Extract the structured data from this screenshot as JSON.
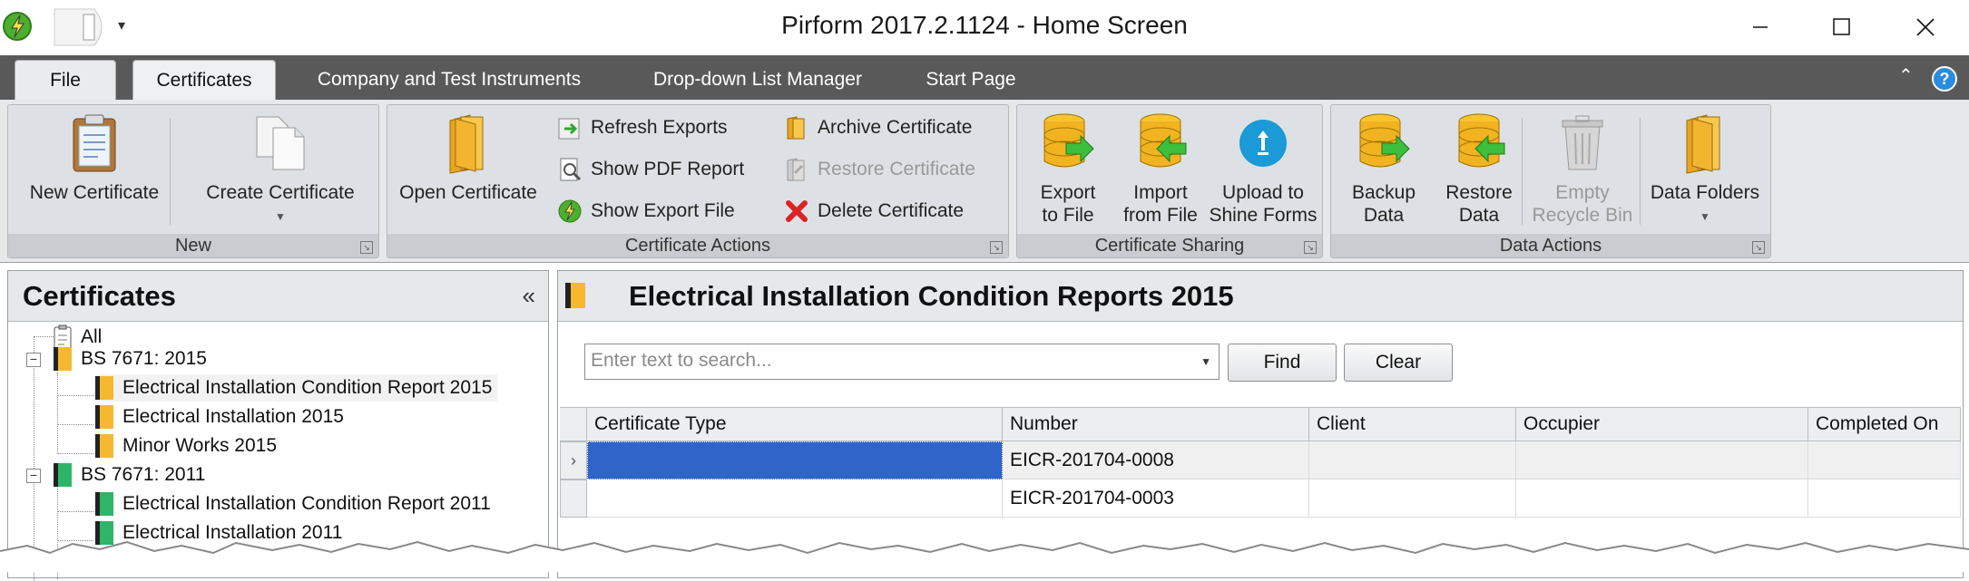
{
  "window": {
    "title": "Pirform 2017.2.1124 - Home Screen",
    "controls": [
      "minimize-icon",
      "maximize-icon",
      "close-icon"
    ]
  },
  "tabs": [
    {
      "label": "File",
      "state": "file"
    },
    {
      "label": "Certificates",
      "state": "active"
    },
    {
      "label": "Company and Test Instruments",
      "state": "normal"
    },
    {
      "label": "Drop-down List Manager",
      "state": "normal"
    },
    {
      "label": "Start Page",
      "state": "normal"
    }
  ],
  "ribbon": {
    "new_group": {
      "title": "New",
      "new_certificate": "New Certificate",
      "create_certificate": "Create Certificate"
    },
    "actions_group": {
      "title": "Certificate Actions",
      "open_certificate": "Open Certificate",
      "refresh_exports": "Refresh Exports",
      "show_pdf_report": "Show PDF Report",
      "show_export_file": "Show Export File",
      "archive_certificate": "Archive Certificate",
      "restore_certificate": "Restore Certificate",
      "delete_certificate": "Delete Certificate"
    },
    "sharing_group": {
      "title": "Certificate Sharing",
      "export_line1": "Export",
      "export_line2": "to File",
      "import_line1": "Import",
      "import_line2": "from File",
      "upload_line1": "Upload to",
      "upload_line2": "Shine Forms"
    },
    "data_group": {
      "title": "Data Actions",
      "backup_line1": "Backup",
      "backup_line2": "Data",
      "restore_line1": "Restore",
      "restore_line2": "Data",
      "empty_line1": "Empty",
      "empty_line2": "Recycle Bin",
      "folders": "Data Folders"
    }
  },
  "left_panel": {
    "title": "Certificates",
    "collapse_glyph": "«",
    "tree": {
      "all": "All",
      "bs2015": "BS 7671: 2015",
      "eicr2015": "Electrical Installation Condition Report 2015",
      "ei2015": "Electrical Installation 2015",
      "mw2015": "Minor Works 2015",
      "bs2011": "BS 7671: 2011",
      "eicr2011": "Electrical Installation Condition Report 2011",
      "ei2011": "Electrical Installation 2011"
    }
  },
  "right_panel": {
    "title": "Electrical Installation Condition Reports 2015",
    "search_placeholder": "Enter text to search...",
    "find_label": "Find",
    "clear_label": "Clear",
    "columns": [
      "Certificate Type",
      "Number",
      "Client",
      "Occupier",
      "Completed On"
    ],
    "rows": [
      {
        "certificate_type": "",
        "number": "EICR-201704-0008",
        "client": "",
        "occupier": "",
        "completed_on": "",
        "selected": true
      },
      {
        "certificate_type": "",
        "number": "EICR-201704-0003",
        "client": "",
        "occupier": "",
        "completed_on": "",
        "selected": false
      }
    ]
  },
  "colors": {
    "tab_bar": "#595959",
    "ribbon_bg": "#e6e8ea",
    "selection": "#2f64c8",
    "tag_2015": "#f5b82e",
    "tag_2011": "#2fb56a"
  }
}
